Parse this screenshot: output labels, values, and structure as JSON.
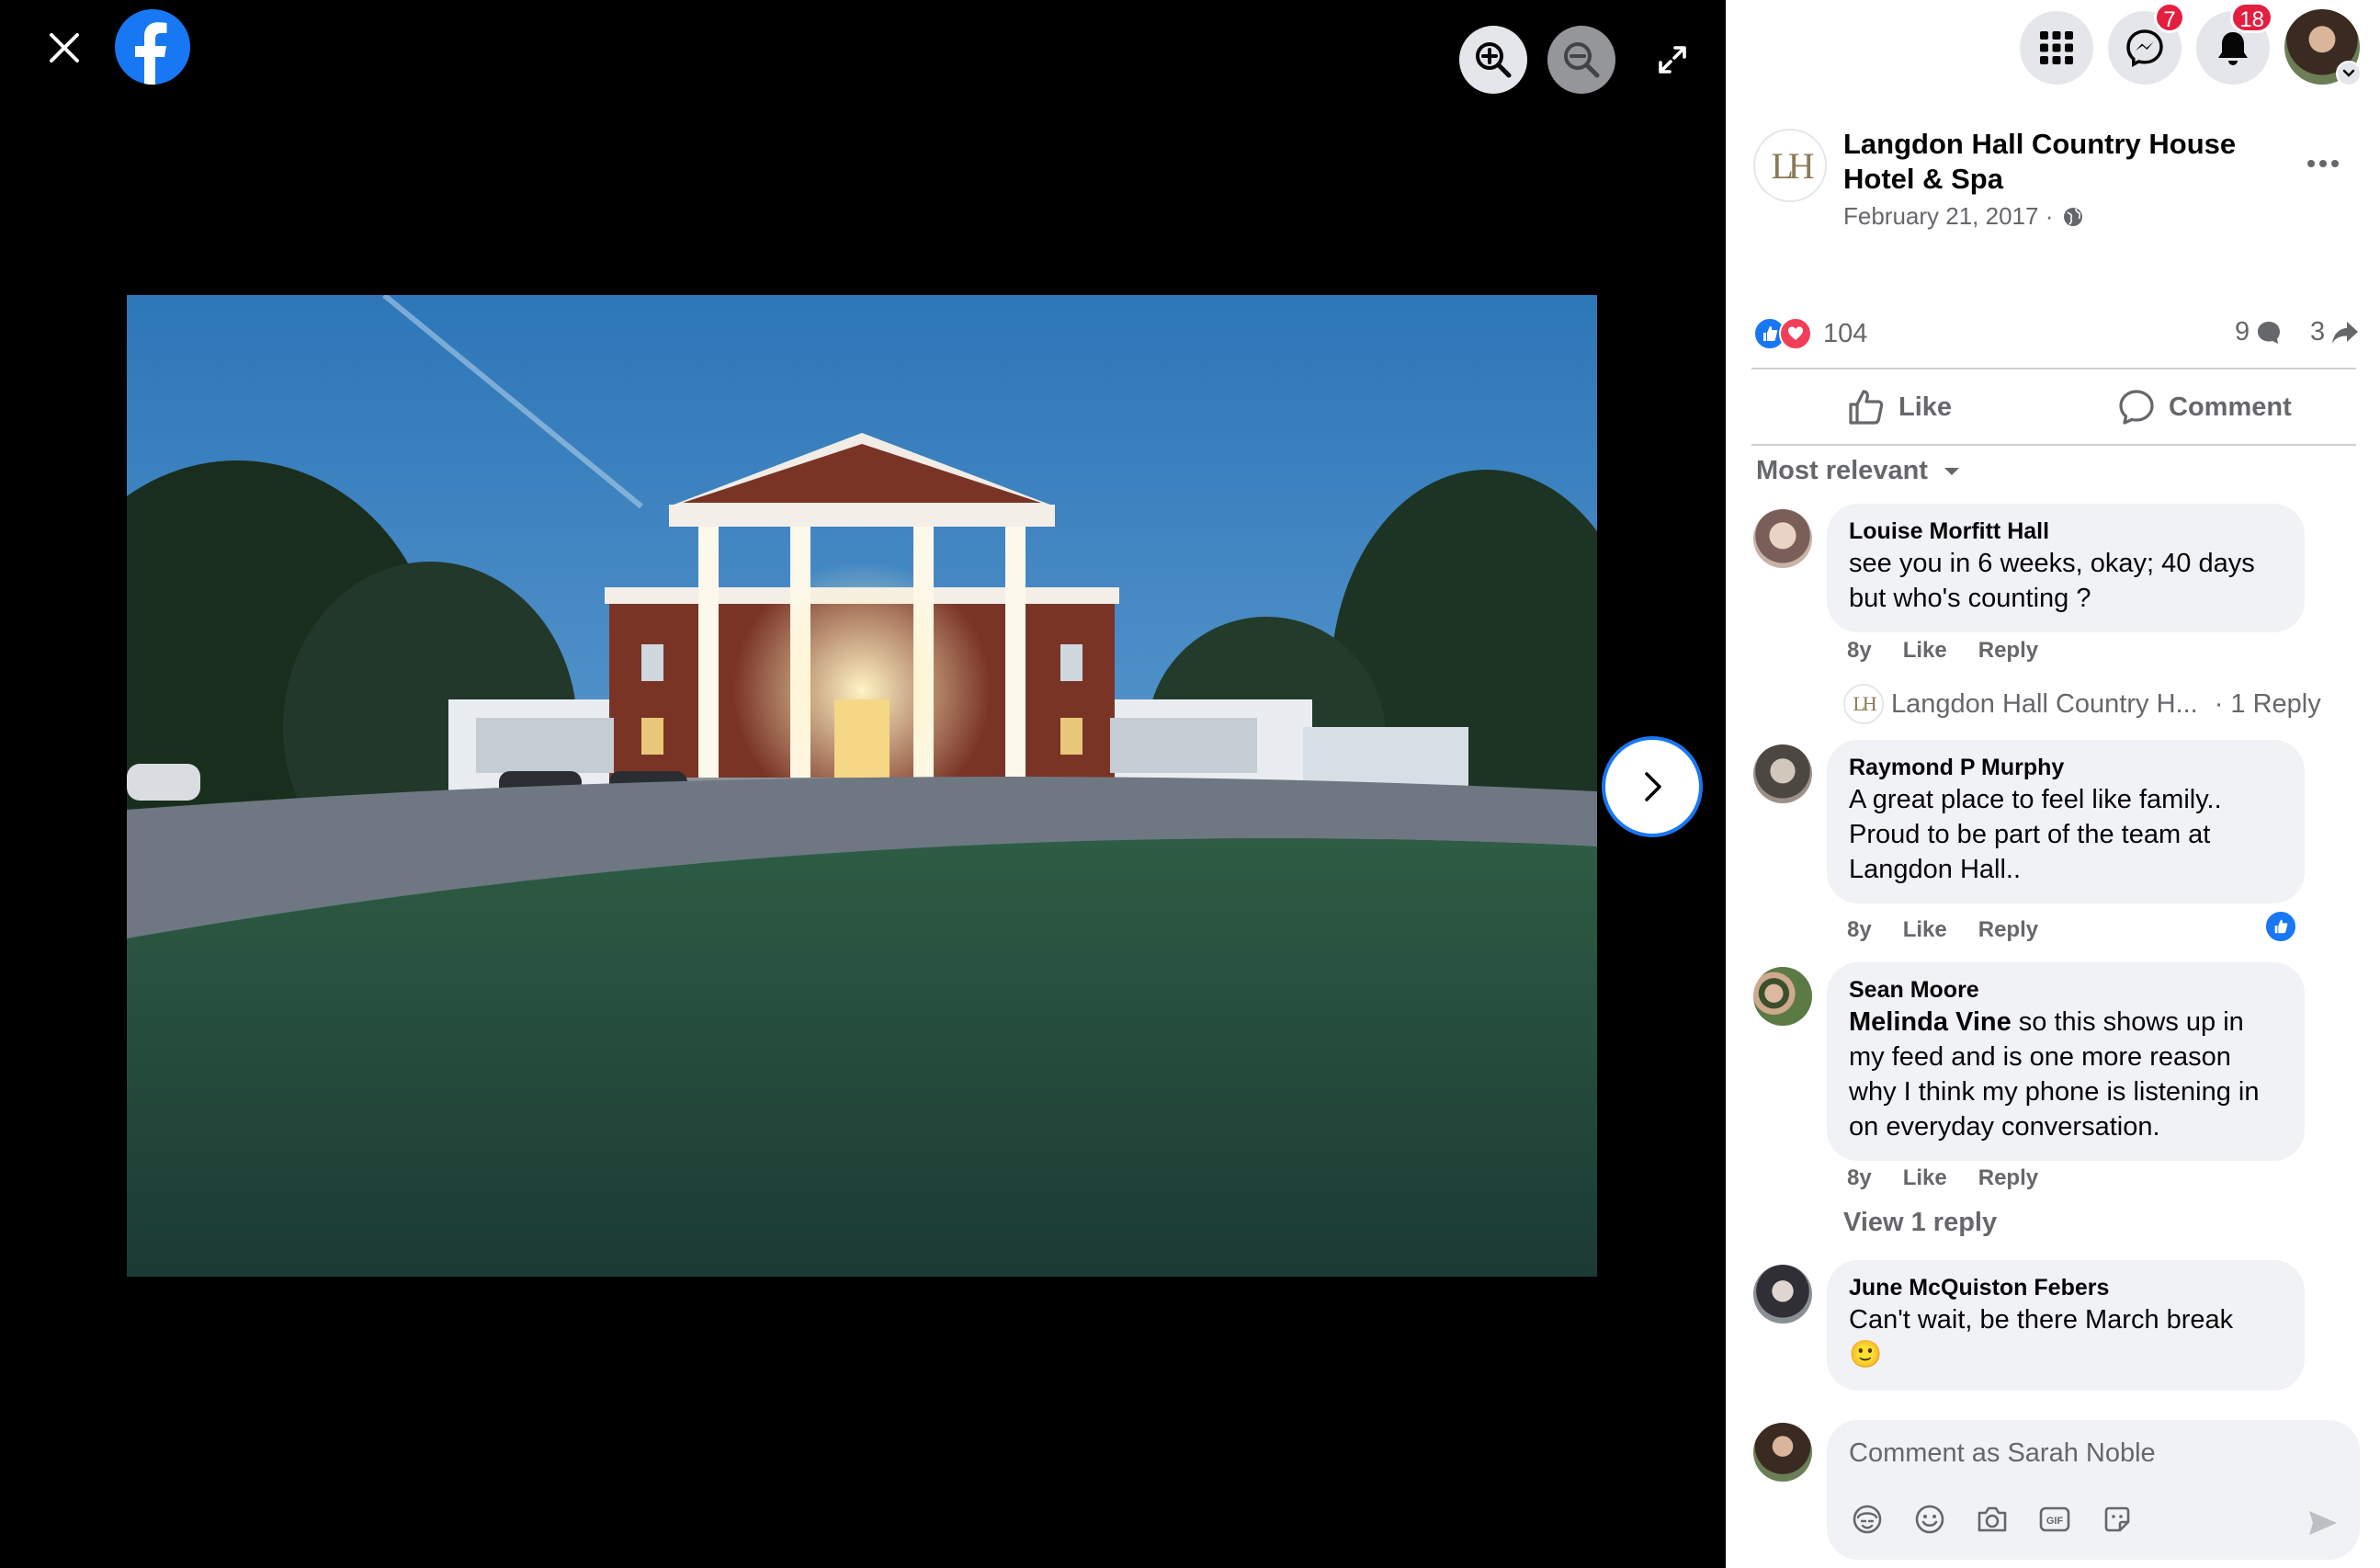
{
  "viewer": {
    "photo_alt": "",
    "icons": {
      "close": "close-icon",
      "logo": "facebook-logo",
      "zoom_in": "zoom-in-icon",
      "zoom_out": "zoom-out-icon",
      "fullscreen": "fullscreen-icon",
      "next": "chevron-right-icon"
    }
  },
  "topbar": {
    "menu_icon": "grid-menu-icon",
    "messenger_badge": "7",
    "notifications_badge": "18"
  },
  "post": {
    "page_name": "Langdon Hall Country House Hotel & Spa",
    "page_initials": "LH",
    "date": "February 21, 2017 ·",
    "privacy_icon": "globe-icon",
    "reaction_count": "104",
    "comment_count": "9",
    "share_count": "3",
    "like_label": "Like",
    "comment_label": "Comment",
    "sort_label": "Most relevant"
  },
  "comments": [
    {
      "author": "Louise Morfitt Hall",
      "text": "see you in 6 weeks, okay; 40 days but who's counting ?",
      "time": "8y",
      "like": "Like",
      "reply": "Reply"
    },
    {
      "author": "Raymond P Murphy",
      "text": "A great place to feel like family.. Proud to be part of the team at Langdon Hall..",
      "time": "8y",
      "like": "Like",
      "reply": "Reply"
    },
    {
      "author": "Sean Moore",
      "mention": "Melinda Vine",
      "text": " so this shows up in my feed and is one more reason why I think my phone is listening in on everyday conversation.",
      "time": "8y",
      "like": "Like",
      "reply": "Reply"
    },
    {
      "author": "June McQuiston Febers",
      "text": "Can't wait, be there March break",
      "emoji": "🙂"
    }
  ],
  "reply_summary": {
    "author": "Langdon Hall Country H...",
    "count": "· 1 Reply"
  },
  "view_reply": "View 1 reply",
  "composer": {
    "placeholder": "Comment as Sarah Noble",
    "tools": [
      "avatar-sticker-icon",
      "emoji-icon",
      "camera-icon",
      "gif-icon",
      "sticker-icon"
    ],
    "send_icon": "send-icon"
  },
  "colors": {
    "brand": "#1877f2",
    "badge": "#e41e3f",
    "secondary_text": "#65676b",
    "bubble": "#f0f2f5"
  }
}
